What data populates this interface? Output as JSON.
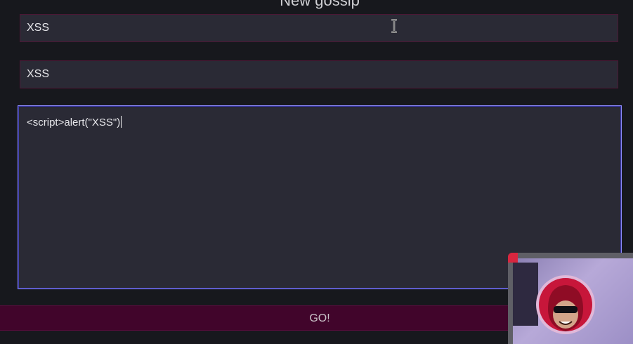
{
  "form": {
    "heading": "New gossip",
    "title_value": "XSS",
    "author_value": "XSS",
    "body_value": "<script>alert(\"XSS\")",
    "submit_label": "GO!"
  },
  "colors": {
    "background": "#17181d",
    "field": "#2a2a35",
    "field_border": "#4c1735",
    "focus_border": "#8e8cff",
    "button": "#41052b"
  },
  "webcam": {
    "icon": "hooded-avatar-icon"
  }
}
